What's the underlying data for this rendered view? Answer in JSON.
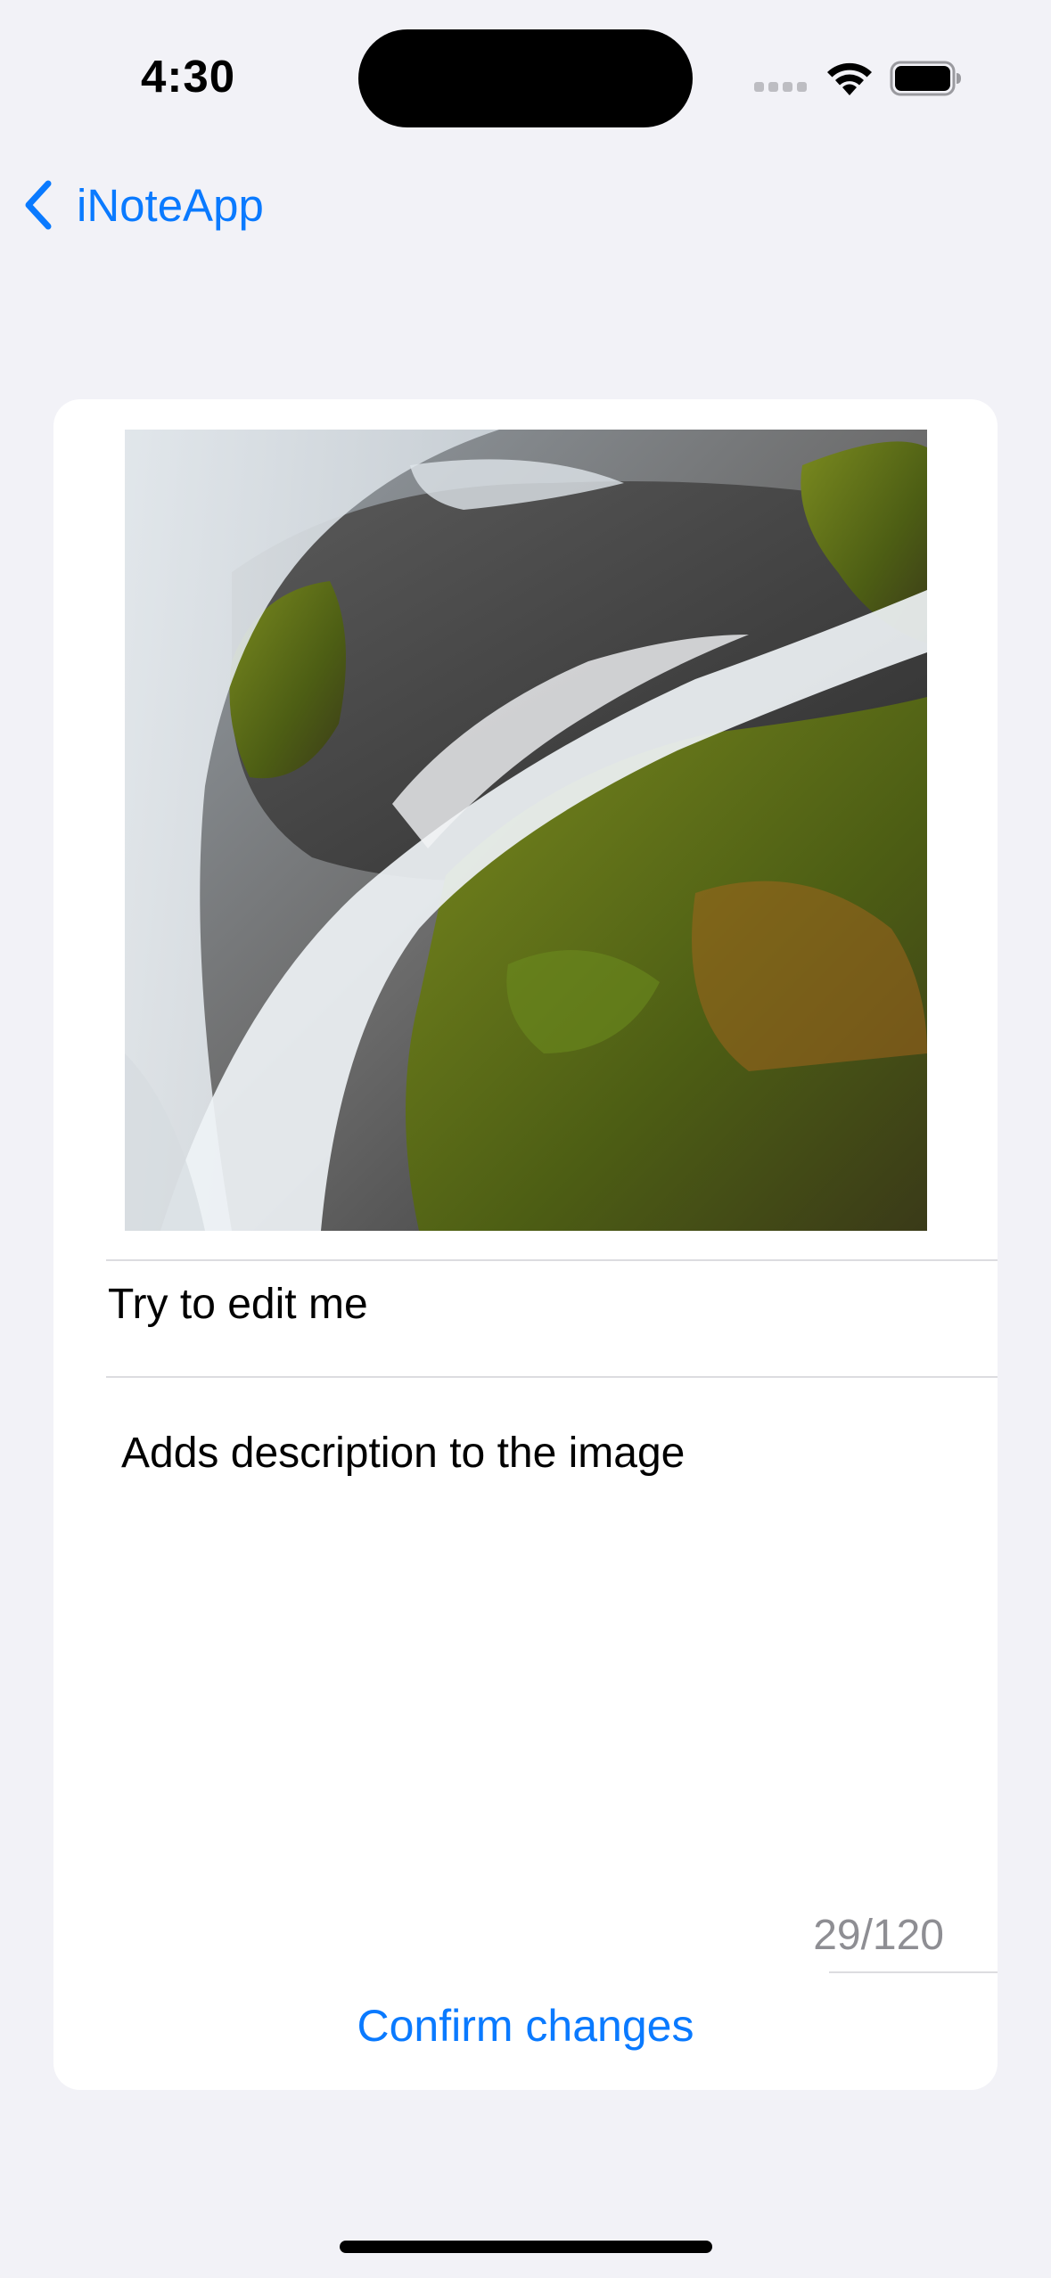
{
  "status_bar": {
    "time": "4:30",
    "icons": [
      "cellular-signal-icon",
      "wifi-icon",
      "battery-icon"
    ]
  },
  "nav": {
    "back_label": "iNoteApp",
    "back_icon": "chevron-left-icon",
    "accent": "#0A7AFF"
  },
  "editor": {
    "title_value": "Try to edit me",
    "description_value": "Adds description to the image",
    "counter": "29/120",
    "confirm_label": "Confirm changes"
  },
  "colors": {
    "background": "#F2F2F7",
    "card": "#FFFFFF",
    "accent": "#0A7AFF",
    "secondary_text": "#8E8E93"
  }
}
